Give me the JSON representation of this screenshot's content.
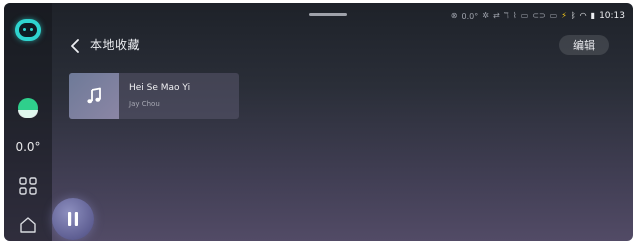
{
  "header": {
    "title": "本地收藏",
    "edit_label": "编辑"
  },
  "rail": {
    "temperature": "0.0°"
  },
  "status_bar": {
    "temperature": "0.0°",
    "time": "10:13"
  },
  "favorites": [
    {
      "title": "Hei Se Mao Yi",
      "artist": "Jay Chou",
      "cover_icon": "music-note-icon"
    }
  ],
  "player": {
    "state_icon": "pause-icon"
  },
  "colors": {
    "accent_teal": "#2fd4cf",
    "android_green": "#2fcf8c",
    "status_yellow": "#f0c419"
  }
}
